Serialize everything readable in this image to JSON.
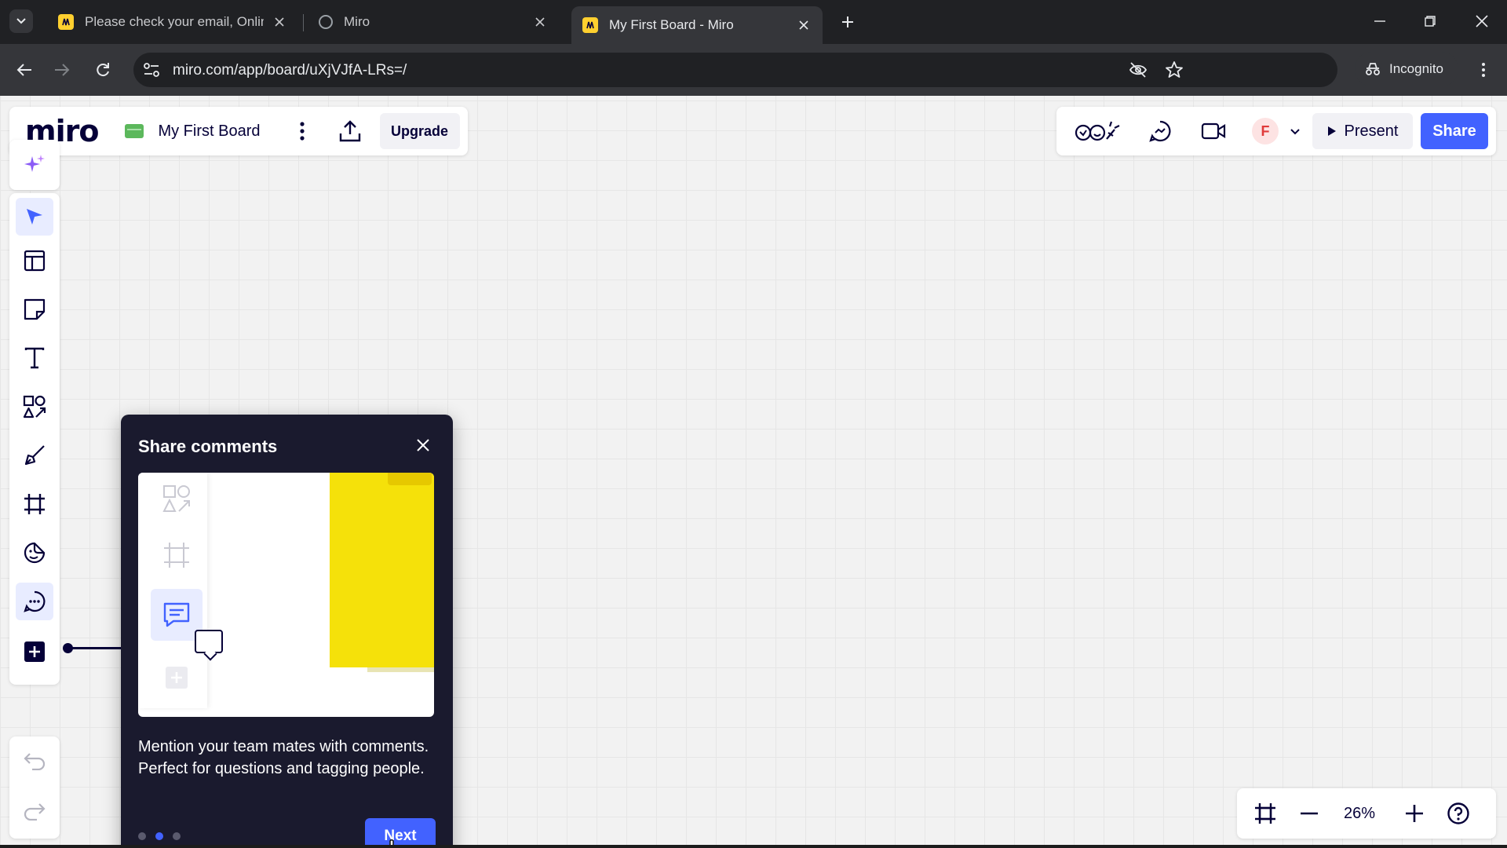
{
  "browser": {
    "tabs": [
      {
        "title": "Please check your email, Online",
        "favicon": "miro-icon"
      },
      {
        "title": "Miro",
        "favicon": "globe-icon"
      },
      {
        "title": "My First Board - Miro",
        "favicon": "miro-icon",
        "active": true
      }
    ],
    "url": "miro.com/app/board/uXjVJfA-LRs=/",
    "incognito_label": "Incognito"
  },
  "board": {
    "logo": "miro",
    "name": "My First Board",
    "upgrade_label": "Upgrade",
    "present_label": "Present",
    "share_label": "Share",
    "avatar_initial": "F",
    "zoom": "26%"
  },
  "toolbar": {
    "tools": [
      "select-tool",
      "templates-tool",
      "sticky-note-tool",
      "text-tool",
      "shapes-tool",
      "pen-tool",
      "frame-tool",
      "stickers-tool",
      "comment-tool",
      "more-apps-tool"
    ]
  },
  "popover": {
    "title": "Share comments",
    "body": "Mention your team mates with comments. Perfect for questions and tagging people.",
    "next_label": "Next",
    "step": 2,
    "total_steps": 3
  },
  "colors": {
    "accent": "#4262ff",
    "sticky": "#f5e10a",
    "popover_bg": "#1a1a2e"
  }
}
